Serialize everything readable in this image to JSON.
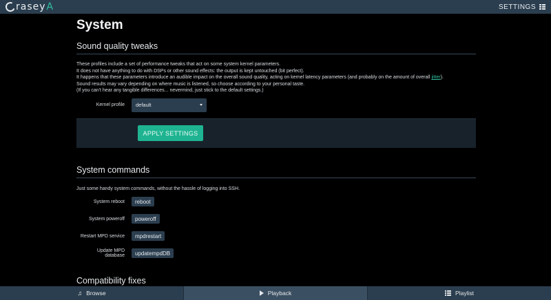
{
  "topbar": {
    "logo_part1": "rasey",
    "logo_part2": "A",
    "settings_label": "SETTINGS"
  },
  "page": {
    "title": "System"
  },
  "sound_quality": {
    "title": "Sound quality tweaks",
    "lines": [
      "These profiles include a set of performance tweaks that act on some system kernel parameters.",
      "It does not have anything to do with DSPs or other sound effects: the output is kept untouched (bit perfect).",
      "It happens that these parameters introduce an audible impact on the overall sound quality, acting on kernel latency parameters (and probably on the amount of overall ",
      "Sound results may vary depending on where music is listened, so choose according to your personal taste.",
      "(If you can't hear any tangible differences... nevermind, just stick to the default settings.)"
    ],
    "jitter_link": "jitter",
    "line3_end": ").",
    "kernel_profile_label": "Kernel profile",
    "kernel_profile_value": "default",
    "apply_button": "APPLY SETTINGS"
  },
  "system_commands": {
    "title": "System commands",
    "intro": "Just some handy system commands, without the hassle of logging into SSH.",
    "rows": [
      {
        "label": "System reboot",
        "button": "reboot"
      },
      {
        "label": "System poweroff",
        "button": "poweroff"
      },
      {
        "label": "Restart MPD service",
        "button": "mpdrestart"
      },
      {
        "label": "Update MPD database",
        "button": "updatempdDB"
      }
    ]
  },
  "compatibility": {
    "title": "Compatibility fixes"
  },
  "bottombar": {
    "tabs": [
      {
        "label": "Browse",
        "icon": "music-note-icon"
      },
      {
        "label": "Playback",
        "icon": "play-icon"
      },
      {
        "label": "Playlist",
        "icon": "list-icon"
      }
    ],
    "active_tab": "Playback"
  },
  "colors": {
    "bar": "#2b3e4f",
    "accent": "#1fb491",
    "background": "#000000"
  }
}
